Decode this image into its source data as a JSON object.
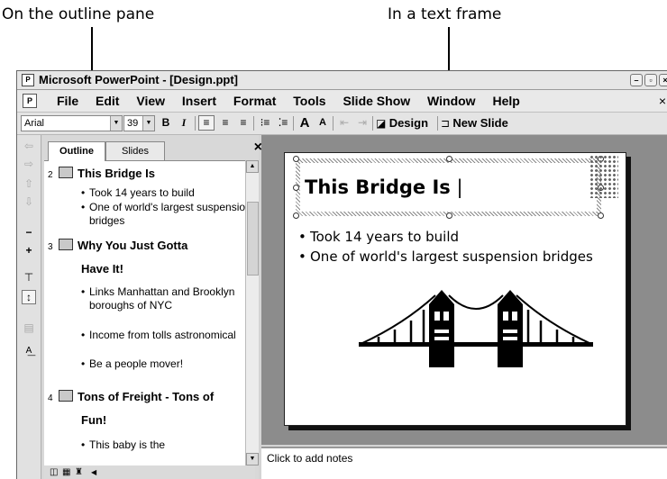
{
  "callouts": {
    "outline_pane": "On the outline pane",
    "text_frame": "In a text frame"
  },
  "window": {
    "title": "Microsoft PowerPoint - [Design.ppt]",
    "app_icon": "powerpoint-icon"
  },
  "menu": {
    "items": [
      "File",
      "Edit",
      "View",
      "Insert",
      "Format",
      "Tools",
      "Slide Show",
      "Window",
      "Help"
    ],
    "close": "×"
  },
  "toolbar": {
    "font": "Arial",
    "size": "39",
    "bold": "B",
    "italic": "I",
    "design": "Design",
    "new_slide": "New Slide"
  },
  "pane": {
    "tabs": [
      "Outline",
      "Slides"
    ],
    "close": "×",
    "active_tab": "Outline"
  },
  "outline": {
    "slides": [
      {
        "num": "2",
        "title": "This Bridge Is",
        "bullets": [
          "Took 14 years to build",
          "One of world's largest suspension bridges"
        ]
      },
      {
        "num": "3",
        "title": "Why You Just Gotta",
        "title_cont": "Have It!",
        "bullets": [
          "Links Manhattan and Brooklyn boroughs of NYC",
          "Income from  tolls astronomical",
          "Be a people mover!"
        ]
      },
      {
        "num": "4",
        "title": "Tons of Freight - Tons of",
        "title_cont": "Fun!",
        "bullets": [
          "This baby is the"
        ]
      }
    ]
  },
  "slide": {
    "title": "This Bridge Is",
    "bullets": [
      "Took 14 years to build",
      "One of world's largest suspension bridges"
    ],
    "image": "bridge-clipart"
  },
  "notes": {
    "placeholder": "Click to add notes"
  }
}
